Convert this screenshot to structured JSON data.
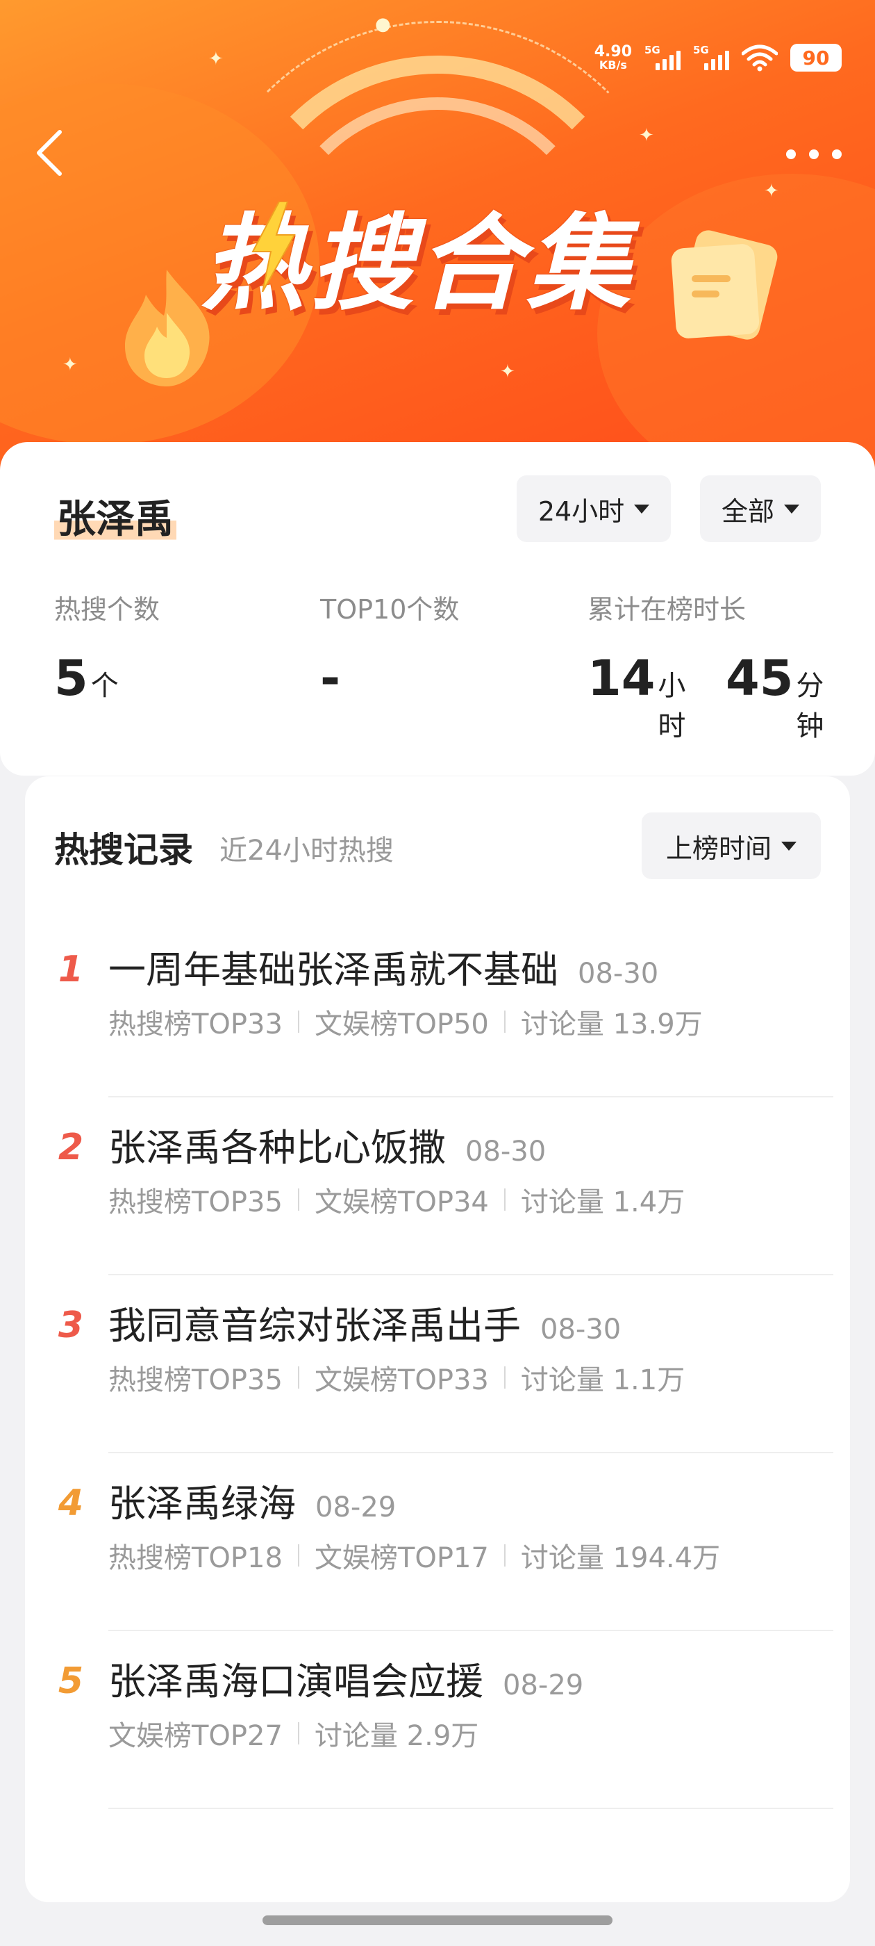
{
  "status_bar": {
    "net_speed_value": "4.90",
    "net_speed_unit": "KB/s",
    "sim1_tag": "5G",
    "sim2_tag": "5G",
    "battery": "90"
  },
  "banner": {
    "title": "热搜合集"
  },
  "summary": {
    "name": "张泽禹",
    "range_filter": "24小时",
    "type_filter": "全部",
    "stats": {
      "hot_label": "热搜个数",
      "hot_value": "5",
      "hot_unit": "个",
      "top10_label": "TOP10个数",
      "top10_value": "-",
      "time_label": "累计在榜时长",
      "time_hours": "14",
      "time_hours_unit": "小时",
      "time_minutes": "45",
      "time_minutes_unit": "分钟"
    }
  },
  "records": {
    "title": "热搜记录",
    "subtitle": "近24小时热搜",
    "sort_filter": "上榜时间",
    "items": [
      {
        "rank": "1",
        "title": "一周年基础张泽禹就不基础",
        "date": "08-30",
        "meta": [
          "热搜榜TOP33",
          "文娱榜TOP50",
          "讨论量 13.9万"
        ]
      },
      {
        "rank": "2",
        "title": "张泽禹各种比心饭撒",
        "date": "08-30",
        "meta": [
          "热搜榜TOP35",
          "文娱榜TOP34",
          "讨论量 1.4万"
        ]
      },
      {
        "rank": "3",
        "title": "我同意音综对张泽禹出手",
        "date": "08-30",
        "meta": [
          "热搜榜TOP35",
          "文娱榜TOP33",
          "讨论量 1.1万"
        ]
      },
      {
        "rank": "4",
        "title": "张泽禹绿海",
        "date": "08-29",
        "meta": [
          "热搜榜TOP18",
          "文娱榜TOP17",
          "讨论量 194.4万"
        ]
      },
      {
        "rank": "5",
        "title": "张泽禹海口演唱会应援",
        "date": "08-29",
        "meta": [
          "文娱榜TOP27",
          "讨论量 2.9万"
        ]
      }
    ]
  },
  "colors": {
    "rank_top3": "#ee5a4a",
    "rank_other": "#f29b34",
    "banner_orange": "#ff6a1f",
    "highlight": "#ffd9b5"
  }
}
